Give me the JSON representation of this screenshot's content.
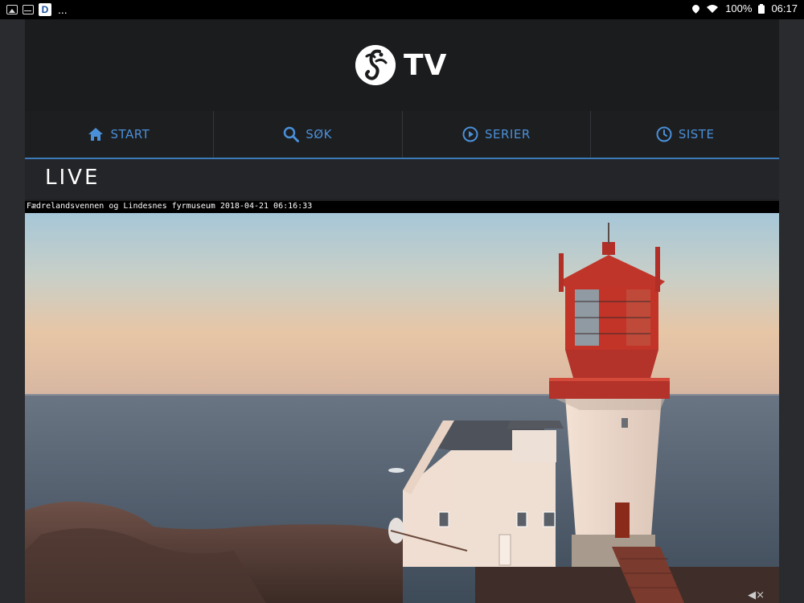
{
  "status_bar": {
    "left_icons": [
      "image-icon",
      "mail-icon",
      "d-app-icon"
    ],
    "d_app_letter": "D",
    "overflow": "...",
    "battery": "100%",
    "time": "06:17"
  },
  "app": {
    "logo_text": "TV"
  },
  "nav": [
    {
      "label": "START",
      "icon": "home-icon"
    },
    {
      "label": "SØK",
      "icon": "search-icon"
    },
    {
      "label": "SERIER",
      "icon": "play-circle-icon"
    },
    {
      "label": "SISTE",
      "icon": "clock-icon"
    }
  ],
  "section": {
    "title": "LIVE"
  },
  "video": {
    "overlay": "Fædrelandsvennen og Lindesnes fyrmuseum 2018-04-21 06:16:33",
    "mute_symbol": "◀×"
  },
  "colors": {
    "accent": "#4a90d9",
    "background": "#1d1e20"
  }
}
